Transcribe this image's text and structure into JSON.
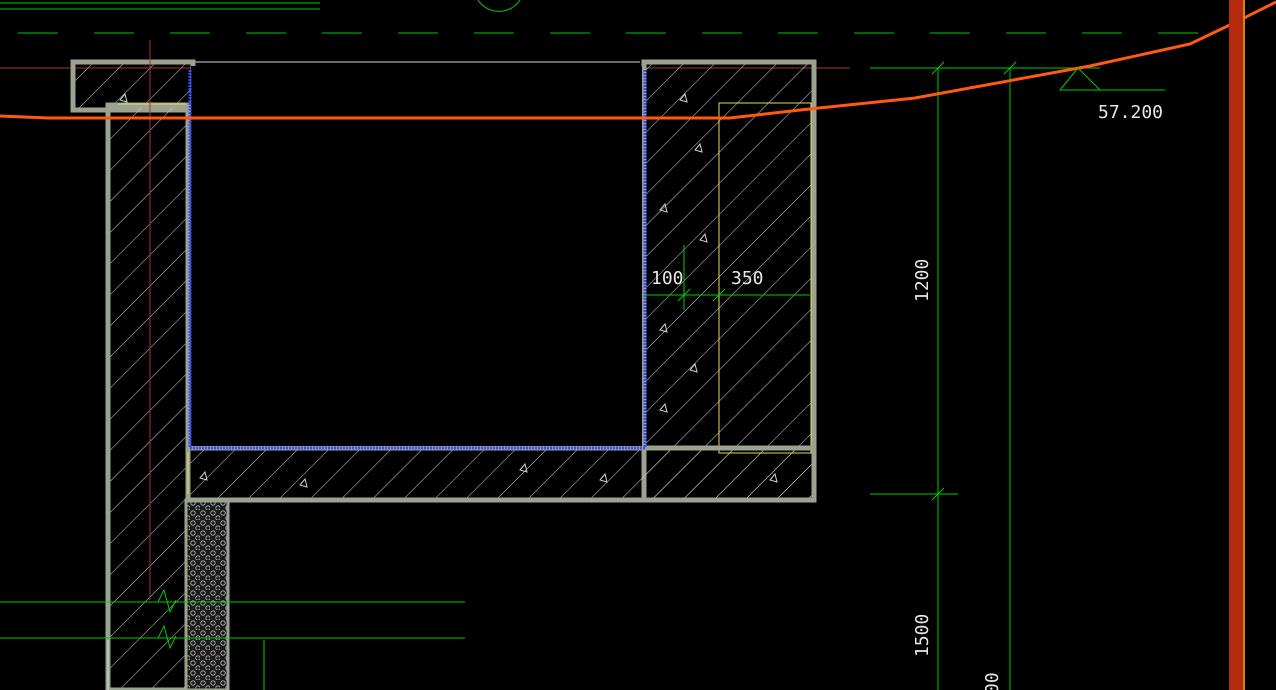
{
  "drawing": {
    "elevation_label": "57.200",
    "dimensions": {
      "inner_thickness": "100",
      "outer_thickness": "350",
      "height_upper": "1200",
      "height_lower": "1500",
      "height_cut": "00"
    }
  },
  "colors": {
    "background": "#000000",
    "concrete_outline": "#9aa38f",
    "hatch": "#c8c8c8",
    "waterproof": "#3a4cff",
    "dimension": "#00cc00",
    "ground_line": "#ff5a14",
    "column": "#b32a0c",
    "centerline": "#a83232",
    "insulation": "#e8dc5a",
    "text": "#e6e6e6"
  }
}
